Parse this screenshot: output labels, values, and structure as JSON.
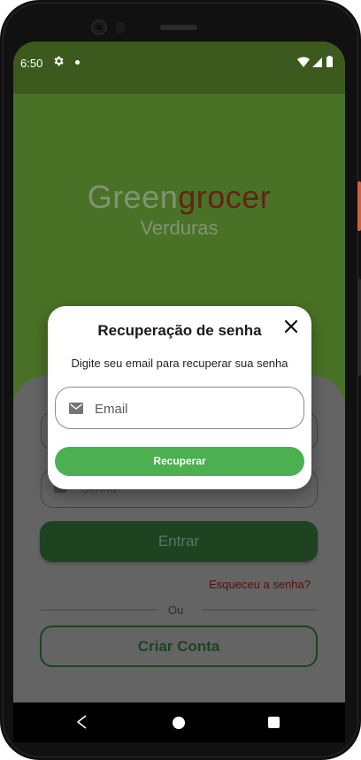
{
  "status_bar": {
    "time": "6:50",
    "icons": [
      "gear-icon",
      "notification-dot",
      "wifi-icon",
      "signal-icon",
      "battery-icon"
    ]
  },
  "app": {
    "logo_part1": "Green",
    "logo_part2": "grocer",
    "subtitle": "Verduras",
    "password_field_label": "Senha",
    "enter_button": "Entrar",
    "forgot_password": "Esqueceu a senha?",
    "divider_text": "Ou",
    "create_account_button": "Criar Conta"
  },
  "dialog": {
    "title": "Recuperação de senha",
    "description": "Digite seu email para recuperar sua senha",
    "email_placeholder": "Email",
    "email_value": "",
    "recover_button": "Recuperar",
    "close_icon": "close-icon"
  },
  "colors": {
    "brand_green": "#4caf50",
    "dark_green": "#245229",
    "background_green": "#5b8b2f",
    "logo_red": "#7a2a1d"
  }
}
